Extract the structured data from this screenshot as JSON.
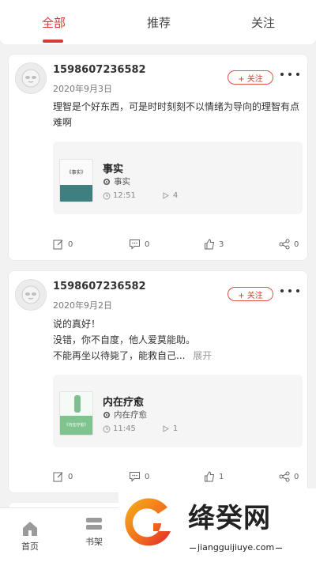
{
  "tabs": [
    {
      "label": "全部"
    },
    {
      "label": "推荐"
    },
    {
      "label": "关注"
    }
  ],
  "accent_color": "#d43c33",
  "posts": [
    {
      "username": "1598607236582",
      "date": "2020年9月3日",
      "follow_label": "+ 关注",
      "content_lines": [
        "理智是个好东西，可是时时刻刻不以情绪为导向的理智有点",
        "难啊"
      ],
      "expand_label": "",
      "book": {
        "title": "事实",
        "subtitle": "事实",
        "duration": "12:51",
        "plays": "4",
        "cover_text": "《事实》"
      },
      "stats": {
        "comments_written": "0",
        "replies": "0",
        "likes": "3",
        "shares": "0"
      }
    },
    {
      "username": "1598607236582",
      "date": "2020年9月2日",
      "follow_label": "+ 关注",
      "content_lines": [
        "说的真好！",
        "没错，你不自度，他人爱莫能助。",
        "不能再坐以待毙了，能救自己..."
      ],
      "expand_label": "展开",
      "book": {
        "title": "内在疗愈",
        "subtitle": "内在疗愈",
        "duration": "11:45",
        "plays": "1",
        "cover_text": "《内在疗愈》"
      },
      "stats": {
        "comments_written": "0",
        "replies": "0",
        "likes": "1",
        "shares": "0"
      }
    }
  ],
  "bottom_nav": [
    {
      "label": "首页",
      "icon": "home-icon"
    },
    {
      "label": "书架",
      "icon": "bookshelf-icon"
    }
  ],
  "watermark": {
    "text": "绛癸网",
    "url": "jiangguijiuye.com"
  }
}
